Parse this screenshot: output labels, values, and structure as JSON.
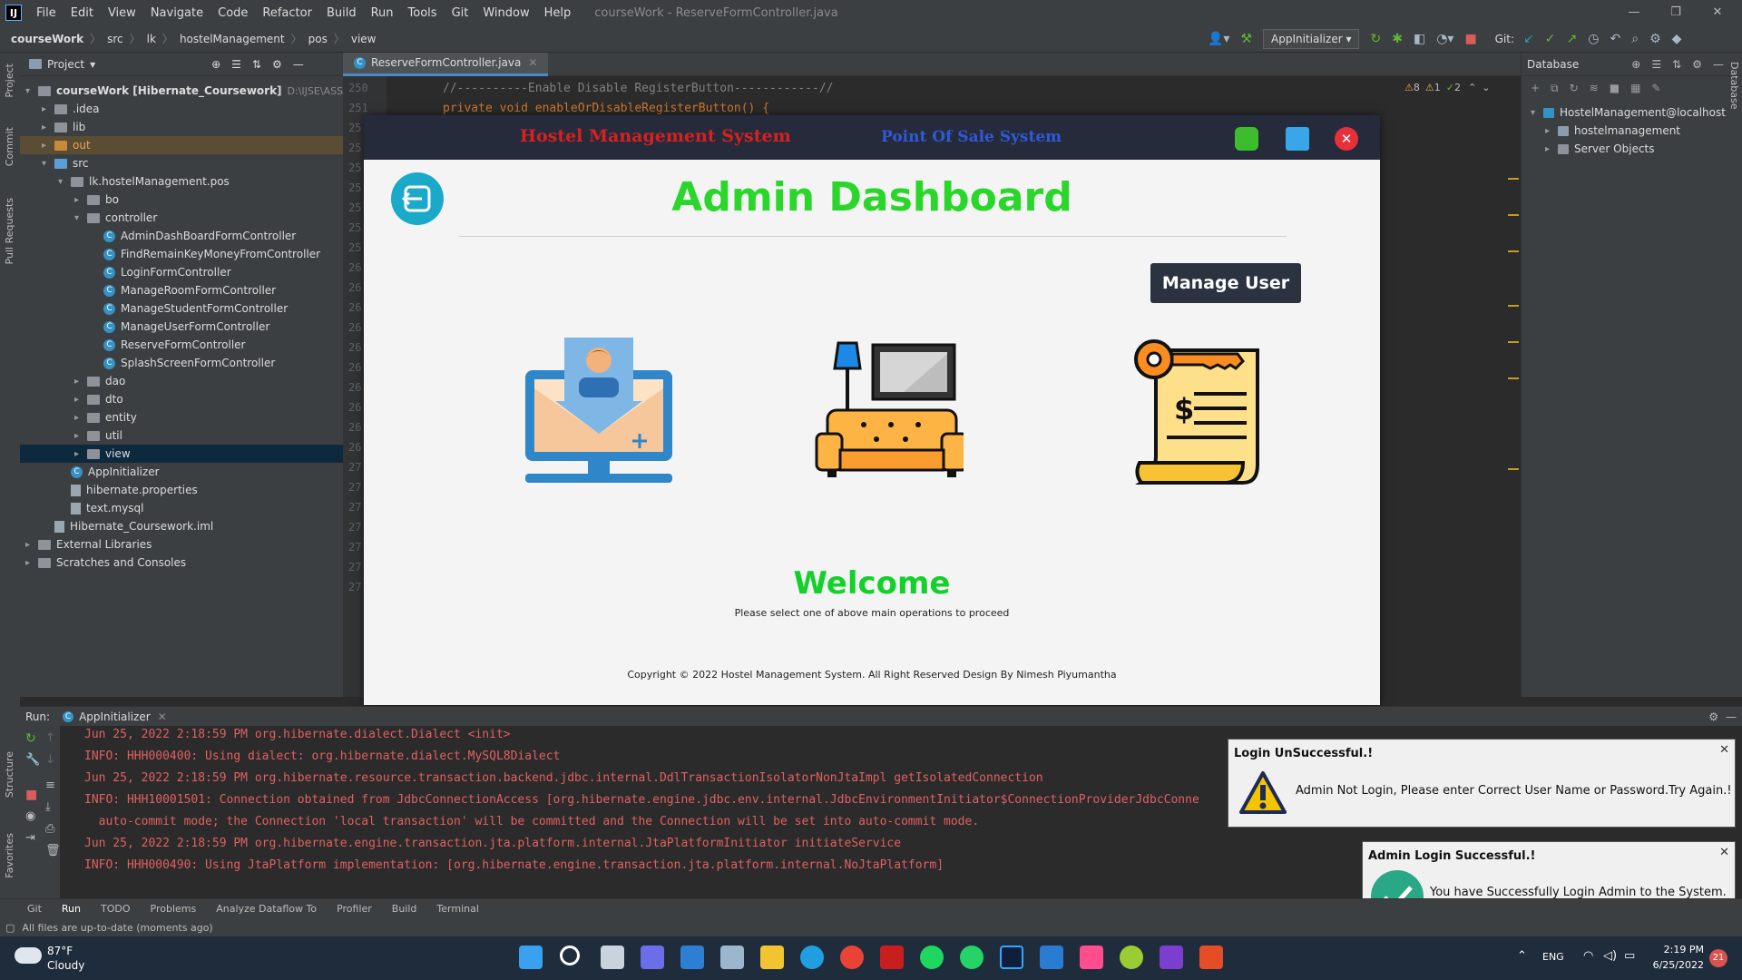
{
  "menubar": {
    "items": [
      "File",
      "Edit",
      "View",
      "Navigate",
      "Code",
      "Refactor",
      "Build",
      "Run",
      "Tools",
      "Git",
      "Window",
      "Help"
    ],
    "window_title": "courseWork - ReserveFormController.java"
  },
  "navbar": {
    "crumbs": [
      "courseWork",
      "src",
      "lk",
      "hostelManagement",
      "pos",
      "view"
    ],
    "run_config": "AppInitializer",
    "git_label": "Git:"
  },
  "leftstrip": {
    "labels": [
      "Project",
      "Commit",
      "Pull Requests",
      "Structure",
      "Favorites"
    ]
  },
  "project": {
    "header": "Project",
    "tree": [
      {
        "label": "courseWork [Hibernate_Coursework]",
        "extra": "D:\\IJSE\\ASSEGEMEN",
        "type": "folder"
      },
      {
        "label": ".idea",
        "type": "folder"
      },
      {
        "label": "lib",
        "type": "folder"
      },
      {
        "label": "out",
        "type": "folder"
      },
      {
        "label": "src",
        "type": "folder"
      },
      {
        "label": "lk.hostelManagement.pos",
        "type": "folder"
      },
      {
        "label": "bo",
        "type": "folder"
      },
      {
        "label": "controller",
        "type": "folder"
      },
      {
        "label": "AdminDashBoardFormController",
        "type": "class"
      },
      {
        "label": "FindRemainKeyMoneyFromController",
        "type": "class"
      },
      {
        "label": "LoginFormController",
        "type": "class"
      },
      {
        "label": "ManageRoomFormController",
        "type": "class"
      },
      {
        "label": "ManageStudentFormController",
        "type": "class"
      },
      {
        "label": "ManageUserFormController",
        "type": "class"
      },
      {
        "label": "ReserveFormController",
        "type": "class"
      },
      {
        "label": "SplashScreenFormController",
        "type": "class"
      },
      {
        "label": "dao",
        "type": "folder"
      },
      {
        "label": "dto",
        "type": "folder"
      },
      {
        "label": "entity",
        "type": "folder"
      },
      {
        "label": "util",
        "type": "folder"
      },
      {
        "label": "view",
        "type": "folder"
      },
      {
        "label": "AppInitializer",
        "type": "class"
      },
      {
        "label": "hibernate.properties",
        "type": "file"
      },
      {
        "label": "text.mysql",
        "type": "file"
      },
      {
        "label": "Hibernate_Coursework.iml",
        "type": "file"
      },
      {
        "label": "External Libraries",
        "type": "folder"
      },
      {
        "label": "Scratches and Consoles",
        "type": "folder"
      }
    ]
  },
  "editor": {
    "tab": "ReserveFormController.java",
    "line_numbers": [
      "250",
      "251",
      "25",
      "25",
      "25",
      "25",
      "25",
      "25",
      "25",
      "26",
      "26",
      "26",
      "26",
      "26",
      "26",
      "26",
      "26",
      "26",
      "26",
      "27",
      "27",
      "27",
      "27",
      "27",
      "27",
      "27"
    ],
    "code": [
      "//----------Enable Disable RegisterButton------------//",
      "private void enableOrDisableRegisterButton() {"
    ],
    "inspections": {
      "warnings": "8",
      "weak": "1",
      "ok": "2"
    }
  },
  "database": {
    "header": "Database",
    "tree": [
      "HostelManagement@localhost",
      "hostelmanagement",
      "Server Objects"
    ]
  },
  "app": {
    "title": "Hostel Management System",
    "subtitle": "Point Of Sale System",
    "heading": "Admin Dashboard",
    "manage_user": "Manage User",
    "welcome": "Welcome",
    "instruction": "Please select one of above main operations to proceed",
    "copyright": "Copyright © 2022  Hostel Management System. All Right Reserved Design By Nimesh Piyumantha"
  },
  "run": {
    "label": "Run:",
    "tab": "AppInitializer",
    "lines": [
      "Jun 25, 2022 2:18:59 PM org.hibernate.dialect.Dialect <init>",
      "INFO: HHH000400: Using dialect: org.hibernate.dialect.MySQL8Dialect",
      "Jun 25, 2022 2:18:59 PM org.hibernate.resource.transaction.backend.jdbc.internal.DdlTransactionIsolatorNonJtaImpl getIsolatedConnection",
      "INFO: HHH10001501: Connection obtained from JdbcConnectionAccess [org.hibernate.engine.jdbc.env.internal.JdbcEnvironmentInitiator$ConnectionProviderJdbcConne",
      "  auto-commit mode; the Connection 'local transaction' will be committed and the Connection will be set into auto-commit mode.",
      "Jun 25, 2022 2:18:59 PM org.hibernate.engine.transaction.jta.platform.internal.JtaPlatformInitiator initiateService",
      "INFO: HHH000490: Using JtaPlatform implementation: [org.hibernate.engine.transaction.jta.platform.internal.NoJtaPlatform]"
    ]
  },
  "bottombar": [
    "Git",
    "Run",
    "TODO",
    "Problems",
    "Analyze Dataflow To",
    "Profiler",
    "Build",
    "Terminal"
  ],
  "status": "All files are up-to-date (moments ago)",
  "notifications": {
    "fail_title": "Login UnSuccessful.!",
    "fail_msg": "Admin Not Login, Please enter Correct User Name or Password.Try Again.!",
    "ok_title": "Admin Login Successful.!",
    "ok_msg": "You have Successfully Login Admin to the System."
  },
  "taskbar": {
    "weather_temp": "87°F",
    "weather_desc": "Cloudy",
    "lang": "ENG",
    "time": "2:19 PM",
    "date": "6/25/2022",
    "badge": "21"
  }
}
